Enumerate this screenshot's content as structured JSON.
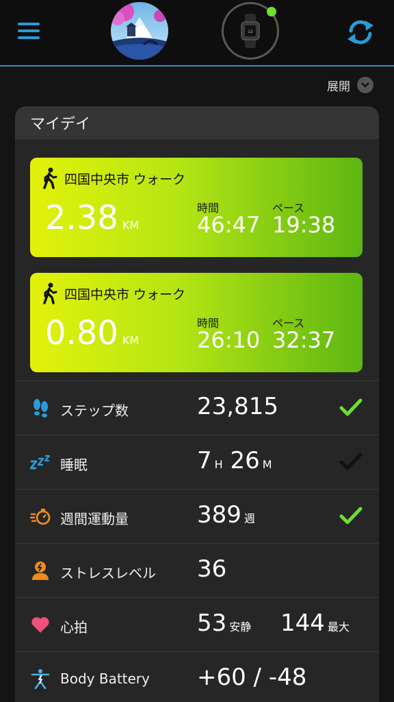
{
  "header": {
    "expand_label": "展開"
  },
  "my_day": {
    "title": "マイデイ",
    "activities": [
      {
        "title": "四国中央市 ウォーク",
        "distance": "2.38",
        "distance_unit": "KM",
        "time_label": "時間",
        "time": "46:47",
        "pace_label": "ペース",
        "pace": "19:38"
      },
      {
        "title": "四国中央市 ウォーク",
        "distance": "0.80",
        "distance_unit": "KM",
        "time_label": "時間",
        "time": "26:10",
        "pace_label": "ペース",
        "pace": "32:37"
      }
    ],
    "stats": {
      "steps": {
        "label": "ステップ数",
        "value": "23,815",
        "goal_met": true
      },
      "sleep": {
        "label": "睡眠",
        "hours": "7",
        "hours_unit": "H",
        "minutes": "26",
        "minutes_unit": "M",
        "goal_met": false
      },
      "intensity": {
        "label": "週間運動量",
        "value": "389",
        "unit": "週",
        "goal_met": true
      },
      "stress": {
        "label": "ストレスレベル",
        "value": "36"
      },
      "heart": {
        "label": "心拍",
        "resting": "53",
        "resting_unit": "安静",
        "max": "144",
        "max_unit": "最大"
      },
      "body_battery": {
        "label": "Body Battery",
        "value": "+60 / -48"
      }
    }
  },
  "colors": {
    "accent_blue": "#2a9ad8",
    "check_green": "#6ee030",
    "check_inactive": "#111111",
    "card_gradient_start": "#e2f20a",
    "card_gradient_end": "#5db612"
  }
}
